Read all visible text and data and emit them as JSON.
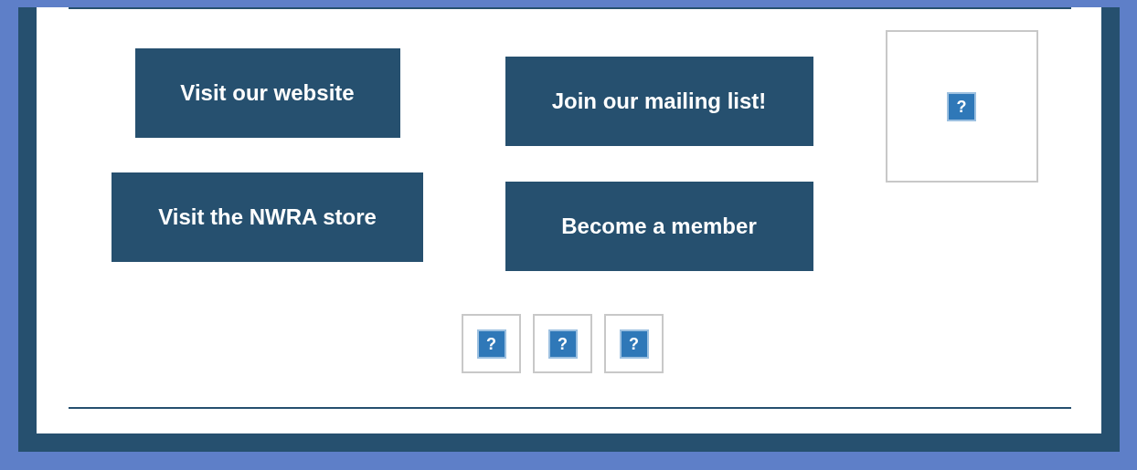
{
  "buttons_left": [
    {
      "label": "Visit our website"
    },
    {
      "label": "Visit the NWRA store"
    }
  ],
  "buttons_middle": [
    {
      "label": "Join our mailing list!"
    },
    {
      "label": "Become a member"
    }
  ],
  "large_image": {
    "icon": "?"
  },
  "small_images": [
    {
      "icon": "?"
    },
    {
      "icon": "?"
    },
    {
      "icon": "?"
    }
  ]
}
